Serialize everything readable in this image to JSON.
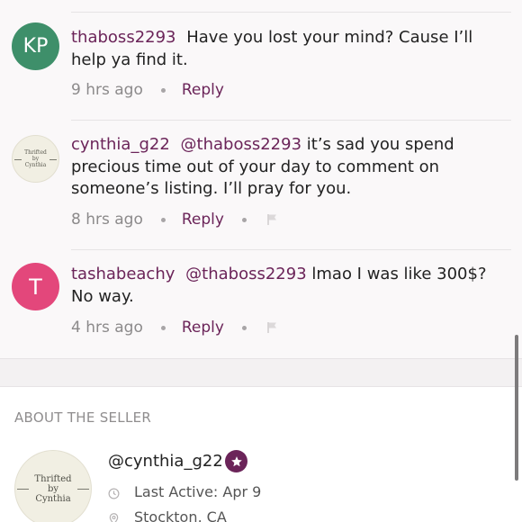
{
  "comments": [
    {
      "avatar_initials": "KP",
      "username": "thaboss2293",
      "mention": "",
      "text": "Have you lost your mind? Cause I’ll help ya find it.",
      "time": "9 hrs ago",
      "reply_label": "Reply",
      "has_flag": false
    },
    {
      "avatar_logo": [
        "Thrifted",
        "by",
        "Cynthia"
      ],
      "username": "cynthia_g22",
      "mention": "@thaboss2293",
      "text": "it’s sad you spend precious time out of your day to comment on someone’s listing. I’ll pray for you.",
      "time": "8 hrs ago",
      "reply_label": "Reply",
      "has_flag": true
    },
    {
      "avatar_initials": "T",
      "username": "tashabeachy",
      "mention": "@thaboss2293",
      "text": "lmao I was like 300$? No way.",
      "time": "4 hrs ago",
      "reply_label": "Reply",
      "has_flag": true
    }
  ],
  "seller": {
    "section_title": "ABOUT THE SELLER",
    "avatar_logo": [
      "Thrifted",
      "by",
      "Cynthia"
    ],
    "username": "@cynthia_g22",
    "last_active": "Last Active: Apr 9",
    "location": "Stockton, CA"
  },
  "colors": {
    "accent": "#6b2459",
    "avatar_kp": "#3e8f6a",
    "avatar_t": "#e3477b"
  },
  "icons": [
    "star-badge-icon",
    "clock-icon",
    "location-pin-icon",
    "flag-icon"
  ]
}
